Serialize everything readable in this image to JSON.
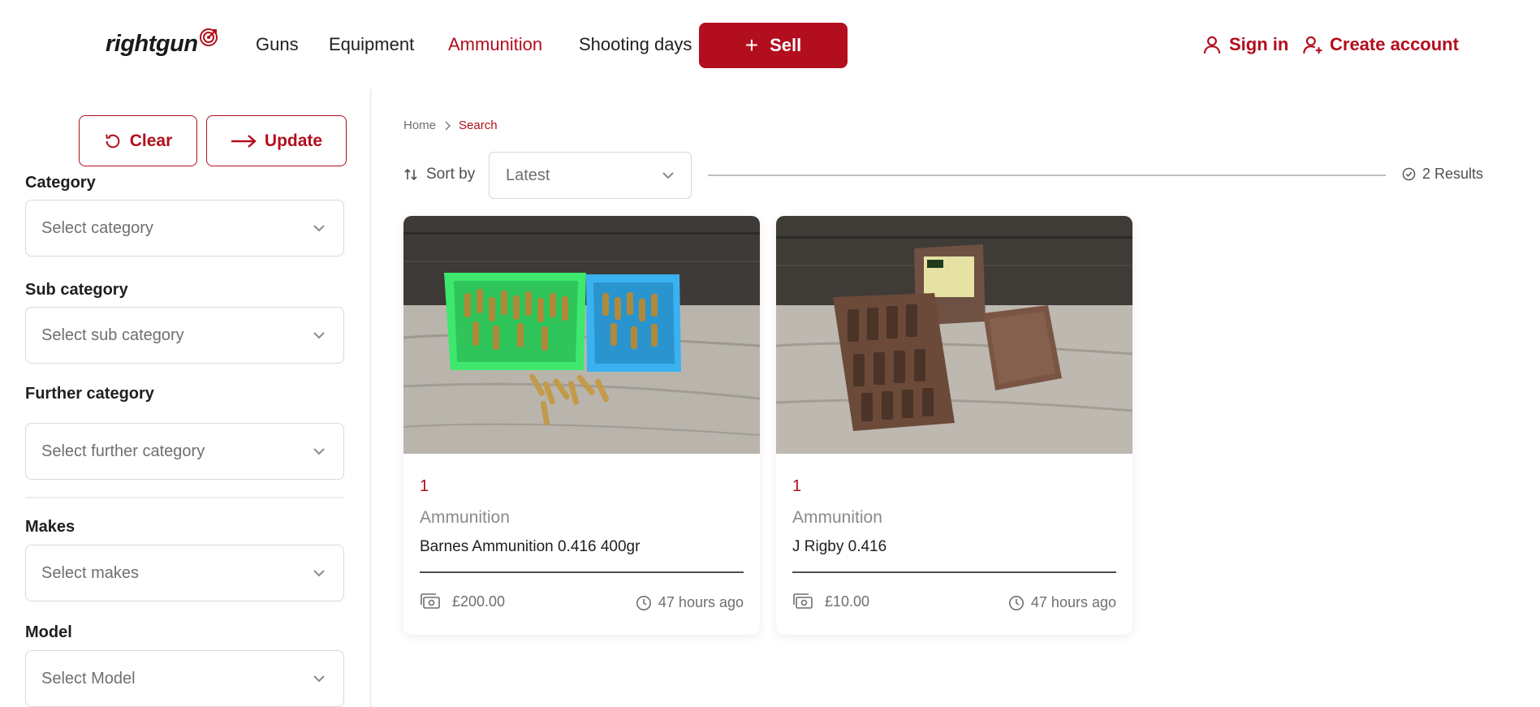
{
  "header": {
    "logo": "rightgun",
    "nav": [
      "Guns",
      "Equipment",
      "Ammunition",
      "Shooting days"
    ],
    "active_nav": "Ammunition",
    "sell_label": "Sell",
    "sign_in_label": "Sign in",
    "create_account_label": "Create account"
  },
  "sidebar": {
    "clear_label": "Clear",
    "update_label": "Update",
    "filters": [
      {
        "label": "Category",
        "placeholder": "Select category"
      },
      {
        "label": "Sub category",
        "placeholder": "Select sub category"
      },
      {
        "label": "Further category",
        "placeholder": "Select further category"
      },
      {
        "label": "Makes",
        "placeholder": "Select makes"
      },
      {
        "label": "Model",
        "placeholder": "Select Model"
      }
    ]
  },
  "breadcrumb": {
    "home": "Home",
    "current": "Search"
  },
  "sort": {
    "label": "Sort by",
    "value": "Latest"
  },
  "results_text": "2 Results",
  "listings": [
    {
      "count": "1",
      "category": "Ammunition",
      "title": "Barnes Ammunition 0.416 400gr",
      "price": "£200.00",
      "time": "47 hours ago"
    },
    {
      "count": "1",
      "category": "Ammunition",
      "title": "J Rigby 0.416",
      "price": "£10.00",
      "time": "47 hours ago"
    }
  ],
  "colors": {
    "accent": "#b30e1d",
    "text": "#1f1f1f",
    "muted": "#6f6f6f",
    "border": "#d9d9d9"
  }
}
